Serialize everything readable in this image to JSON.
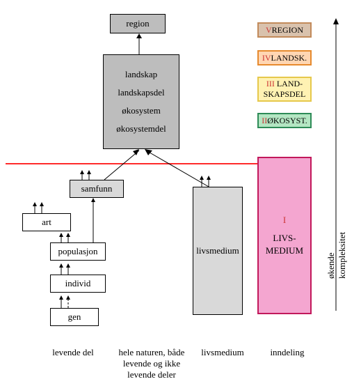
{
  "boxes": {
    "region": "region",
    "landskap": "landskap",
    "landskapsdel": "landskapsdel",
    "okosystem": "økosystem",
    "okosystemdel": "økosystemdel",
    "samfunn": "samfunn",
    "art": "art",
    "populasjon": "populasjon",
    "individ": "individ",
    "gen": "gen",
    "livsmedium": "livsmedium",
    "livsmedium_big_l1": "I",
    "livsmedium_big_l2": "LIVS-",
    "livsmedium_big_l3": "MEDIUM"
  },
  "legend": {
    "v_num": "V",
    "v_text": " REGION",
    "iv_num": "IV",
    "iv_text": " LANDSK.",
    "iii_num": "III",
    "iii_text_l1": " LAND-",
    "iii_text_l2": "SKAPSDEL",
    "ii_num": "II",
    "ii_text": " ØKOSYST."
  },
  "axis": {
    "complexity": "økende kompleksitet"
  },
  "bottom": {
    "levende": "levende del",
    "hele_l1": "hele naturen, både",
    "hele_l2": "levende og ikke",
    "hele_l3": "levende deler",
    "livsmedium": "livsmedium",
    "inndeling": "inndeling"
  },
  "colors": {
    "legend_v_border": "#c28a5a",
    "legend_v_bg": "#d9c2ad",
    "legend_v_num": "#cc3333",
    "legend_iv_border": "#e68a2e",
    "legend_iv_bg": "#ffd6b3",
    "legend_iv_num": "#cc3333",
    "legend_iii_border": "#e6c84b",
    "legend_iii_bg": "#fff2b3",
    "legend_iii_num": "#cc3333",
    "legend_ii_border": "#2e8b57",
    "legend_ii_bg": "#b3e6c2",
    "legend_ii_num": "#cc3333",
    "livsmedium_border": "#c2185b",
    "livsmedium_bg": "#f4a6d0",
    "livsmedium_num": "#cc3333"
  }
}
